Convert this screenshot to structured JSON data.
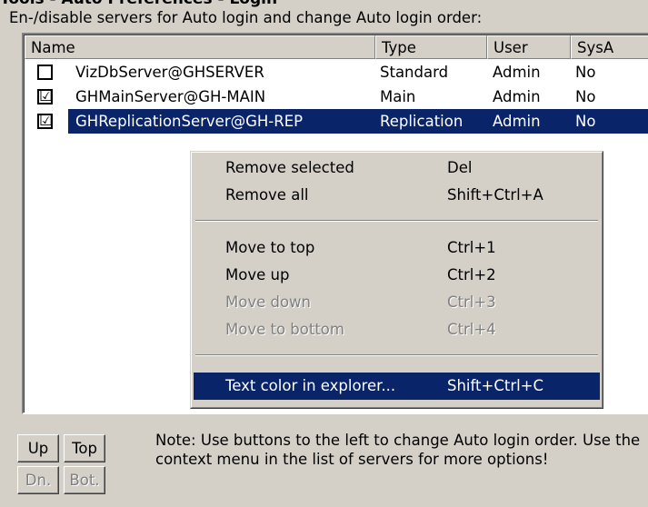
{
  "window": {
    "title": "Tools - Auto Preferences - Login"
  },
  "section_label": "En-/disable servers for Auto login and change Auto login order:",
  "columns": {
    "name": "Name",
    "type": "Type",
    "user": "User",
    "sysa": "SysA"
  },
  "rows": [
    {
      "checked": false,
      "name": "VizDbServer@GHSERVER",
      "type": "Standard",
      "user": "Admin",
      "sysa": "No"
    },
    {
      "checked": true,
      "name": "GHMainServer@GH-MAIN",
      "type": "Main",
      "user": "Admin",
      "sysa": "No"
    },
    {
      "checked": true,
      "name": "GHReplicationServer@GH-REP",
      "type": "Replication",
      "user": "Admin",
      "sysa": "No",
      "selected": true
    }
  ],
  "check_mark": "☑",
  "context_menu": {
    "items": [
      {
        "label": "Remove selected",
        "shortcut": "Del"
      },
      {
        "label": "Remove all",
        "shortcut": "Shift+Ctrl+A"
      },
      {
        "label": "Move to top",
        "shortcut": "Ctrl+1"
      },
      {
        "label": "Move up",
        "shortcut": "Ctrl+2"
      },
      {
        "label": "Move down",
        "shortcut": "Ctrl+3",
        "disabled": true
      },
      {
        "label": "Move to bottom",
        "shortcut": "Ctrl+4",
        "disabled": true
      },
      {
        "label": "Text color in explorer...",
        "shortcut": "Shift+Ctrl+C",
        "highlighted": true
      }
    ]
  },
  "buttons": {
    "up": "Up",
    "top": "Top",
    "down": "Dn.",
    "bottom": "Bot."
  },
  "note": "Note: Use buttons to the left to change Auto login order. Use the context menu in the list of servers for more options!",
  "colors": {
    "selection": "#0a246a",
    "dialog_bg": "#d4d0c8",
    "list_bg": "#ffffff",
    "disabled_text": "#808080"
  }
}
